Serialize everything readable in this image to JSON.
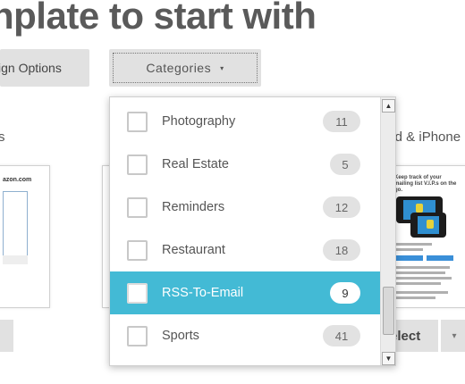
{
  "heading": "nplate to start with",
  "buttons": {
    "design_options": "ign Options",
    "categories": "Categories",
    "select": "elect"
  },
  "sections": {
    "left_label": "s",
    "right_label": "oid & iPhone"
  },
  "thumbnails": {
    "left_logo": "azon.com",
    "right_title": "Keep track of your mailing list V.I.P.s on the go."
  },
  "dropdown": {
    "items": [
      {
        "label": "Photography",
        "count": "11",
        "checked": false
      },
      {
        "label": "Real Estate",
        "count": "5",
        "checked": false
      },
      {
        "label": "Reminders",
        "count": "12",
        "checked": false
      },
      {
        "label": "Restaurant",
        "count": "18",
        "checked": false
      },
      {
        "label": "RSS-To-Email",
        "count": "9",
        "checked": false,
        "highlighted": true
      },
      {
        "label": "Sports",
        "count": "41",
        "checked": false
      }
    ]
  },
  "colors": {
    "highlight": "#43bad5",
    "button_gray": "#e1e1e1",
    "heading": "#5a5a5a"
  },
  "icons": {
    "caret": "▾",
    "scroll_up": "▲",
    "scroll_down": "▼"
  }
}
